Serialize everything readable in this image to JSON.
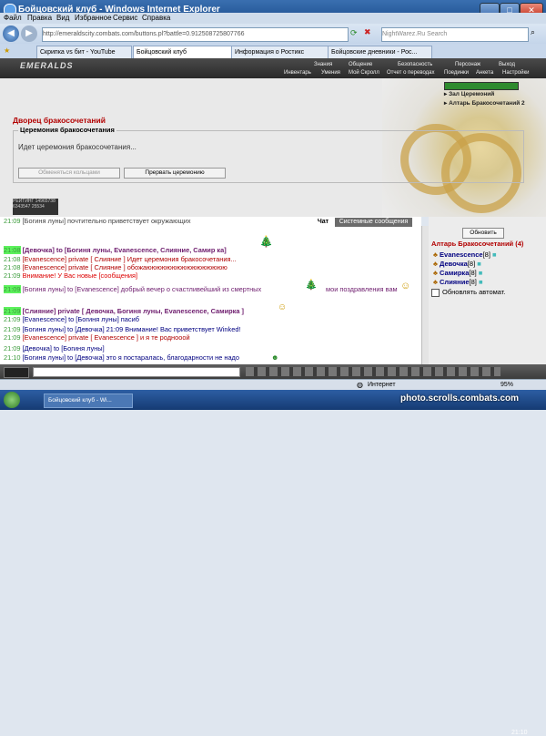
{
  "window": {
    "title": "Бойцовский клуб - Windows Internet Explorer",
    "minimize": "_",
    "maximize": "□",
    "close": "✕"
  },
  "menubar": [
    "Файл",
    "Правка",
    "Вид",
    "Избранное",
    "Сервис",
    "Справка"
  ],
  "address": {
    "url": "http://emeraldscity.combats.com/buttons.pl?battle=0.912508725807766",
    "search_placeholder": "NightWarez.Ru Search"
  },
  "tabs": [
    {
      "label": "Скрипка vs бит - YouTube"
    },
    {
      "label": "Бойцовский клуб",
      "active": true
    },
    {
      "label": "Информация о Ростикс"
    },
    {
      "label": "Бойцовские дневники - Рос..."
    }
  ],
  "game": {
    "logo": "EMERALDS",
    "menu_top": [
      "Знания",
      "Общение",
      "Безопасность",
      "Персонаж",
      "Выход"
    ],
    "menu_bottom": [
      "Инвентарь",
      "Умения",
      "Мой Скролл",
      "Отчет о переводах",
      "Поединки",
      "Анкета",
      "Настройки"
    ],
    "right_links": [
      "Зал Церемоний",
      "Алтарь Бракосочетаний 2"
    ],
    "page_title": "Дворец бракосочетаний",
    "fieldset_legend": "Церемония бракосочетания",
    "ceremony_text": "Идет церемония бракосочетания...",
    "swap_rings_btn": "Обменяться кольцами",
    "abort_btn": "Прервать церемонию",
    "counter_text": "РЕЙТИНГ 14965738 6343547 25534"
  },
  "chat_tabs": {
    "chat": "Чат",
    "system": "Системные сообщения"
  },
  "chat": [
    {
      "time": "21:09",
      "text": "[Богиня луны] почтительно приветствует окружающих"
    },
    {
      "time": "21:08",
      "text": "[Девочка] to [Богиня луны, Evanescence, Слияние, Самир ка]"
    },
    {
      "time": "21:08",
      "text": "[Evanescence] private [ Слияние ] Идет церемония бракосочетания..."
    },
    {
      "time": "21:08",
      "text": "[Evanescence] private [ Слияние ] обожаюююююююююююююююю"
    },
    {
      "time": "21:09",
      "text": "Внимание! У Вас новые [сообщения]"
    },
    {
      "time": "21:09",
      "text": "[Богиня луны] to [Evanescence] добрый вечер о счастливейший из смертных",
      "extra": "мои поздравления вам"
    },
    {
      "time": "21:09",
      "text": "[Слияние] private [ Девочка, Богиня луны, Evanescence, Самирка ]"
    },
    {
      "time": "21:09",
      "text": "[Evanescence] to [Богиня луны] пасиб"
    },
    {
      "time": "21:09",
      "text": "[Богиня луны] to [Девочка] 21:09 Внимание! Вас приветствует Winked!"
    },
    {
      "time": "21:09",
      "text": "[Evanescence] private [ Evanescence ] и я те роднооой"
    },
    {
      "time": "21:09",
      "text": "[Девочка] to [Богиня луны]"
    },
    {
      "time": "21:10",
      "text": "[Богиня луны] to [Девочка] это я постаралась, благодарности не надо"
    }
  ],
  "right_panel": {
    "refresh_btn": "Обновить",
    "altar_title": "Алтарь Бракосочетаний (4)",
    "users": [
      {
        "name": "Evanescence",
        "level": "[8]"
      },
      {
        "name": "Девочка",
        "level": "[8]"
      },
      {
        "name": "Самирка",
        "level": "[8]"
      },
      {
        "name": "Слияние",
        "level": "[8]"
      }
    ],
    "auto_refresh": "Обновлять автомат."
  },
  "game_clock": "21:10",
  "ie_status": {
    "zone": "Интернет",
    "zoom": "95%"
  },
  "taskbar": {
    "item": "Бойцовский клуб - Wi..."
  },
  "watermark": "photo.scrolls.combats.com"
}
